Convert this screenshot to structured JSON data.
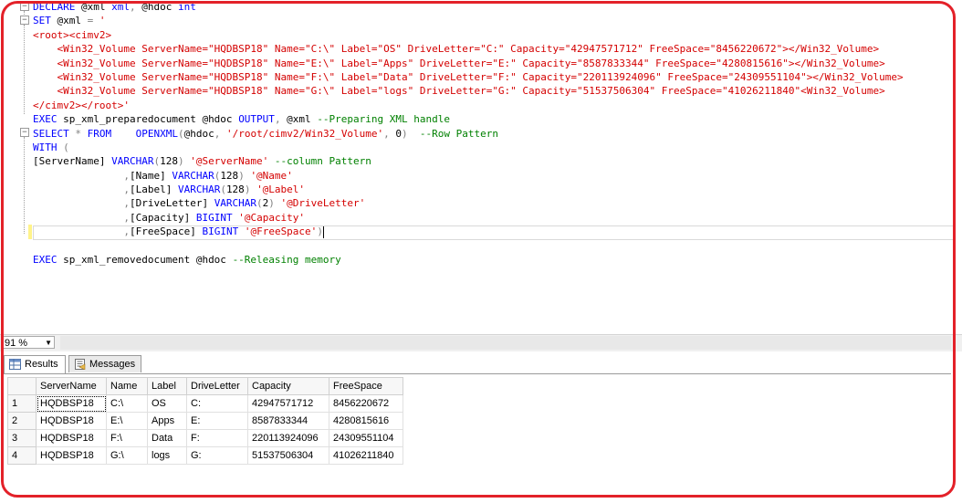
{
  "editor": {
    "lines": [
      "DECLARE @xml xml, @hdoc int",
      "SET @xml = '",
      "<root><cimv2>",
      "    <Win32_Volume ServerName=\"HQDBSP18\" Name=\"C:\\\" Label=\"OS\" DriveLetter=\"C:\" Capacity=\"42947571712\" FreeSpace=\"8456220672\"></Win32_Volume>",
      "    <Win32_Volume ServerName=\"HQDBSP18\" Name=\"E:\\\" Label=\"Apps\" DriveLetter=\"E:\" Capacity=\"8587833344\" FreeSpace=\"4280815616\"></Win32_Volume>",
      "    <Win32_Volume ServerName=\"HQDBSP18\" Name=\"F:\\\" Label=\"Data\" DriveLetter=\"F:\" Capacity=\"220113924096\" FreeSpace=\"24309551104\"></Win32_Volume>",
      "    <Win32_Volume ServerName=\"HQDBSP18\" Name=\"G:\\\" Label=\"logs\" DriveLetter=\"G:\" Capacity=\"51537506304\" FreeSpace=\"41026211840\"<Win32_Volume>",
      "</cimv2></root>'",
      "EXEC sp_xml_preparedocument @hdoc OUTPUT, @xml --Preparing XML handle",
      "SELECT * FROM    OPENXML(@hdoc, '/root/cimv2/Win32_Volume', 0)  --Row Pattern",
      "WITH (",
      "[ServerName] VARCHAR(128) '@ServerName' --column Pattern",
      "               ,[Name] VARCHAR(128) '@Name'",
      "               ,[Label] VARCHAR(128) '@Label'",
      "               ,[DriveLetter] VARCHAR(2) '@DriveLetter'",
      "               ,[Capacity] BIGINT '@Capacity'",
      "               ,[FreeSpace] BIGINT '@FreeSpace')",
      "",
      "EXEC sp_xml_removedocument @hdoc --Releasing memory"
    ]
  },
  "zoom": {
    "value": "91 %"
  },
  "tabs": [
    {
      "label": "Results",
      "icon": "grid-icon",
      "active": true
    },
    {
      "label": "Messages",
      "icon": "messages-icon",
      "active": false
    }
  ],
  "results": {
    "columns": [
      "ServerName",
      "Name",
      "Label",
      "DriveLetter",
      "Capacity",
      "FreeSpace"
    ],
    "rows": [
      [
        "1",
        "HQDBSP18",
        "C:\\",
        "OS",
        "C:",
        "42947571712",
        "8456220672"
      ],
      [
        "2",
        "HQDBSP18",
        "E:\\",
        "Apps",
        "E:",
        "8587833344",
        "4280815616"
      ],
      [
        "3",
        "HQDBSP18",
        "F:\\",
        "Data",
        "F:",
        "220113924096",
        "24309551104"
      ],
      [
        "4",
        "HQDBSP18",
        "G:\\",
        "logs",
        "G:",
        "51537506304",
        "41026211840"
      ]
    ]
  },
  "colors": {
    "frame": "#e32129",
    "keyword": "#0000ff",
    "string": "#d40000",
    "comment": "#008000"
  }
}
